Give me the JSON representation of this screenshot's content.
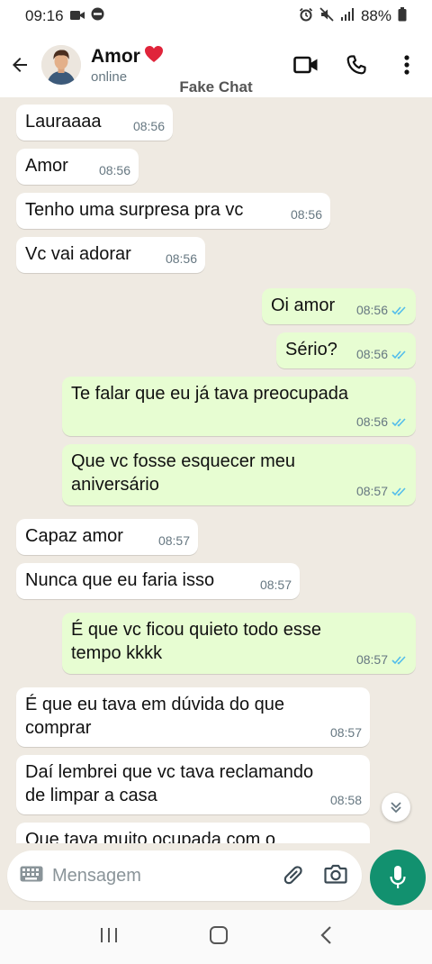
{
  "status_bar": {
    "time": "09:16",
    "battery": "88%"
  },
  "header": {
    "contact_name": "Amor",
    "status": "online",
    "watermark": "Fake Chat"
  },
  "colors": {
    "outgoing_bubble": "#e7fdd2",
    "incoming_bubble": "#ffffff",
    "chat_bg": "#efeae2",
    "accent": "#12916f",
    "read_ticks": "#53bdeb"
  },
  "messages": [
    {
      "dir": "in",
      "text": "Lauraaaa",
      "time": "08:56"
    },
    {
      "dir": "in",
      "text": "Amor",
      "time": "08:56"
    },
    {
      "dir": "in",
      "text": "Tenho uma surpresa pra vc",
      "time": "08:56"
    },
    {
      "dir": "in",
      "text": "Vc vai adorar",
      "time": "08:56"
    },
    {
      "dir": "out",
      "text": "Oi amor",
      "time": "08:56"
    },
    {
      "dir": "out",
      "text": "Sério?",
      "time": "08:56"
    },
    {
      "dir": "out",
      "text": "Te falar que eu já tava preocupada",
      "time": "08:56"
    },
    {
      "dir": "out",
      "text": "Que vc fosse esquecer meu\naniversário",
      "time": "08:57"
    },
    {
      "dir": "in",
      "text": "Capaz amor",
      "time": "08:57"
    },
    {
      "dir": "in",
      "text": "Nunca que eu faria isso",
      "time": "08:57"
    },
    {
      "dir": "out",
      "text": "É que vc ficou quieto todo esse\ntempo kkkk",
      "time": "08:57"
    },
    {
      "dir": "in",
      "text": "É que eu tava em dúvida do que\ncomprar",
      "time": "08:57"
    },
    {
      "dir": "in",
      "text": "Daí lembrei que vc tava reclamando\nde limpar a casa",
      "time": "08:58"
    },
    {
      "dir": "in",
      "text": "Que tava muito ocupada com o",
      "time": ""
    }
  ],
  "input": {
    "placeholder": "Mensagem"
  }
}
